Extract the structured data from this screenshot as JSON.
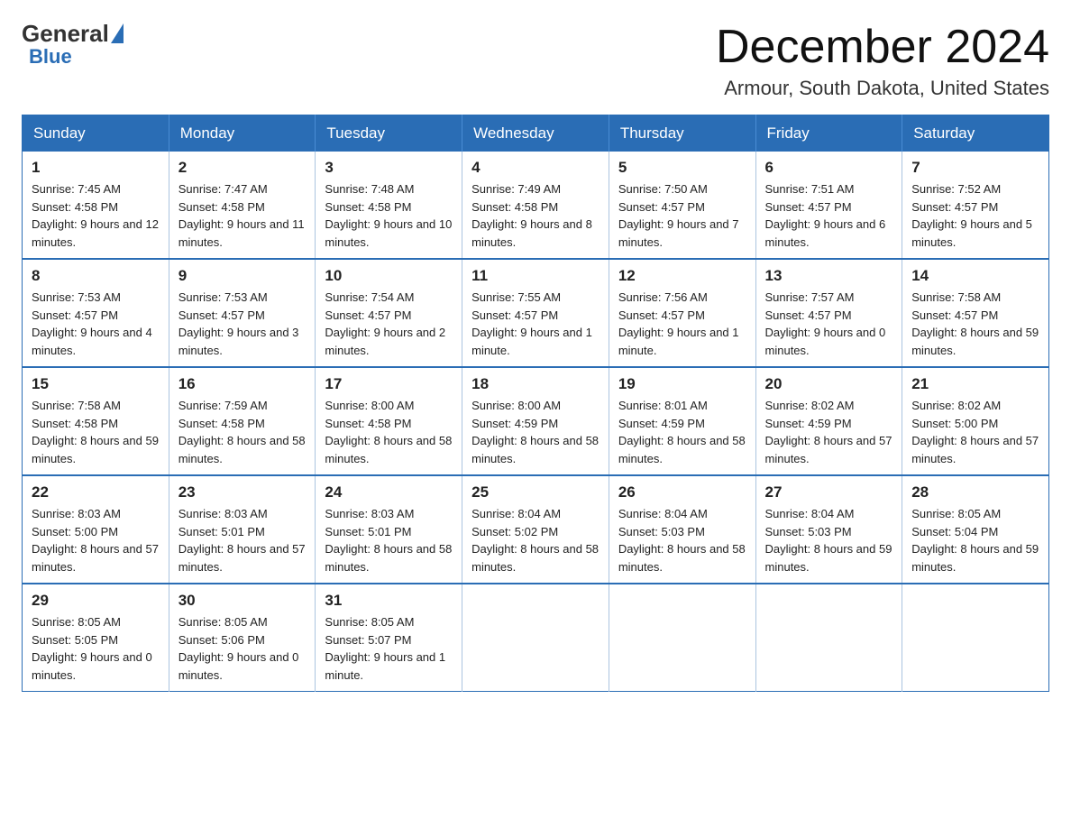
{
  "header": {
    "logo_general": "General",
    "logo_blue": "Blue",
    "month_title": "December 2024",
    "location": "Armour, South Dakota, United States"
  },
  "days_of_week": [
    "Sunday",
    "Monday",
    "Tuesday",
    "Wednesday",
    "Thursday",
    "Friday",
    "Saturday"
  ],
  "weeks": [
    [
      {
        "day": "1",
        "sunrise": "7:45 AM",
        "sunset": "4:58 PM",
        "daylight": "9 hours and 12 minutes."
      },
      {
        "day": "2",
        "sunrise": "7:47 AM",
        "sunset": "4:58 PM",
        "daylight": "9 hours and 11 minutes."
      },
      {
        "day": "3",
        "sunrise": "7:48 AM",
        "sunset": "4:58 PM",
        "daylight": "9 hours and 10 minutes."
      },
      {
        "day": "4",
        "sunrise": "7:49 AM",
        "sunset": "4:58 PM",
        "daylight": "9 hours and 8 minutes."
      },
      {
        "day": "5",
        "sunrise": "7:50 AM",
        "sunset": "4:57 PM",
        "daylight": "9 hours and 7 minutes."
      },
      {
        "day": "6",
        "sunrise": "7:51 AM",
        "sunset": "4:57 PM",
        "daylight": "9 hours and 6 minutes."
      },
      {
        "day": "7",
        "sunrise": "7:52 AM",
        "sunset": "4:57 PM",
        "daylight": "9 hours and 5 minutes."
      }
    ],
    [
      {
        "day": "8",
        "sunrise": "7:53 AM",
        "sunset": "4:57 PM",
        "daylight": "9 hours and 4 minutes."
      },
      {
        "day": "9",
        "sunrise": "7:53 AM",
        "sunset": "4:57 PM",
        "daylight": "9 hours and 3 minutes."
      },
      {
        "day": "10",
        "sunrise": "7:54 AM",
        "sunset": "4:57 PM",
        "daylight": "9 hours and 2 minutes."
      },
      {
        "day": "11",
        "sunrise": "7:55 AM",
        "sunset": "4:57 PM",
        "daylight": "9 hours and 1 minute."
      },
      {
        "day": "12",
        "sunrise": "7:56 AM",
        "sunset": "4:57 PM",
        "daylight": "9 hours and 1 minute."
      },
      {
        "day": "13",
        "sunrise": "7:57 AM",
        "sunset": "4:57 PM",
        "daylight": "9 hours and 0 minutes."
      },
      {
        "day": "14",
        "sunrise": "7:58 AM",
        "sunset": "4:57 PM",
        "daylight": "8 hours and 59 minutes."
      }
    ],
    [
      {
        "day": "15",
        "sunrise": "7:58 AM",
        "sunset": "4:58 PM",
        "daylight": "8 hours and 59 minutes."
      },
      {
        "day": "16",
        "sunrise": "7:59 AM",
        "sunset": "4:58 PM",
        "daylight": "8 hours and 58 minutes."
      },
      {
        "day": "17",
        "sunrise": "8:00 AM",
        "sunset": "4:58 PM",
        "daylight": "8 hours and 58 minutes."
      },
      {
        "day": "18",
        "sunrise": "8:00 AM",
        "sunset": "4:59 PM",
        "daylight": "8 hours and 58 minutes."
      },
      {
        "day": "19",
        "sunrise": "8:01 AM",
        "sunset": "4:59 PM",
        "daylight": "8 hours and 58 minutes."
      },
      {
        "day": "20",
        "sunrise": "8:02 AM",
        "sunset": "4:59 PM",
        "daylight": "8 hours and 57 minutes."
      },
      {
        "day": "21",
        "sunrise": "8:02 AM",
        "sunset": "5:00 PM",
        "daylight": "8 hours and 57 minutes."
      }
    ],
    [
      {
        "day": "22",
        "sunrise": "8:03 AM",
        "sunset": "5:00 PM",
        "daylight": "8 hours and 57 minutes."
      },
      {
        "day": "23",
        "sunrise": "8:03 AM",
        "sunset": "5:01 PM",
        "daylight": "8 hours and 57 minutes."
      },
      {
        "day": "24",
        "sunrise": "8:03 AM",
        "sunset": "5:01 PM",
        "daylight": "8 hours and 58 minutes."
      },
      {
        "day": "25",
        "sunrise": "8:04 AM",
        "sunset": "5:02 PM",
        "daylight": "8 hours and 58 minutes."
      },
      {
        "day": "26",
        "sunrise": "8:04 AM",
        "sunset": "5:03 PM",
        "daylight": "8 hours and 58 minutes."
      },
      {
        "day": "27",
        "sunrise": "8:04 AM",
        "sunset": "5:03 PM",
        "daylight": "8 hours and 59 minutes."
      },
      {
        "day": "28",
        "sunrise": "8:05 AM",
        "sunset": "5:04 PM",
        "daylight": "8 hours and 59 minutes."
      }
    ],
    [
      {
        "day": "29",
        "sunrise": "8:05 AM",
        "sunset": "5:05 PM",
        "daylight": "9 hours and 0 minutes."
      },
      {
        "day": "30",
        "sunrise": "8:05 AM",
        "sunset": "5:06 PM",
        "daylight": "9 hours and 0 minutes."
      },
      {
        "day": "31",
        "sunrise": "8:05 AM",
        "sunset": "5:07 PM",
        "daylight": "9 hours and 1 minute."
      },
      null,
      null,
      null,
      null
    ]
  ],
  "labels": {
    "sunrise_prefix": "Sunrise: ",
    "sunset_prefix": "Sunset: ",
    "daylight_prefix": "Daylight: "
  }
}
